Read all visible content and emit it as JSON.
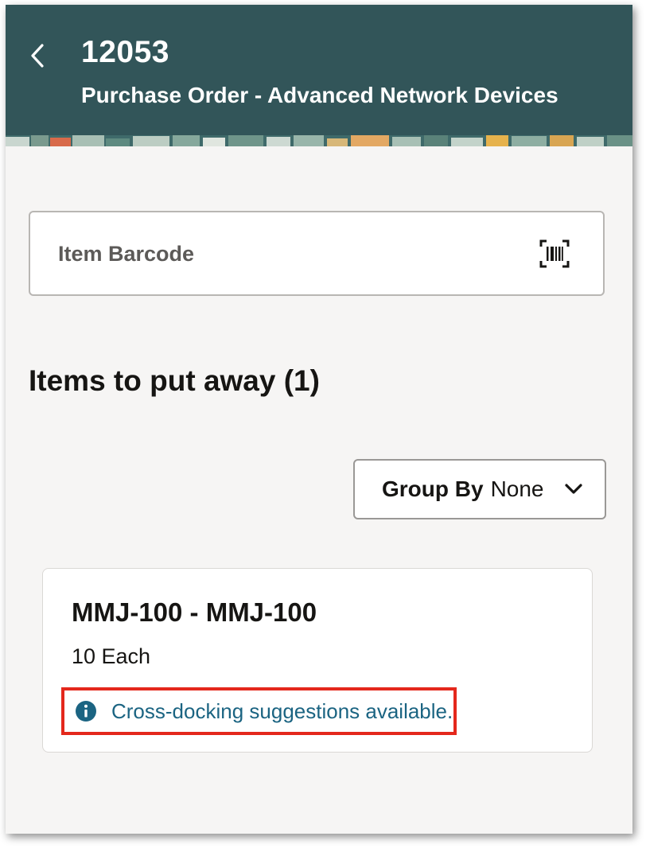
{
  "header": {
    "title": "12053",
    "subtitle": "Purchase Order - Advanced Network Devices",
    "back_icon": "chevron-left-icon",
    "background_color": "#325559"
  },
  "barcode": {
    "placeholder": "Item Barcode",
    "icon": "barcode-scan-icon"
  },
  "items_section": {
    "heading": "Items to put away (1)"
  },
  "group_by": {
    "label": "Group By",
    "value": "None",
    "icon": "chevron-down-icon"
  },
  "items": [
    {
      "title": "MMJ-100 - MMJ-100",
      "quantity": "10 Each",
      "notice": "Cross-docking suggestions available.",
      "notice_icon": "info-icon",
      "notice_color": "#1b6482",
      "highlight_color": "#e4281c"
    }
  ]
}
